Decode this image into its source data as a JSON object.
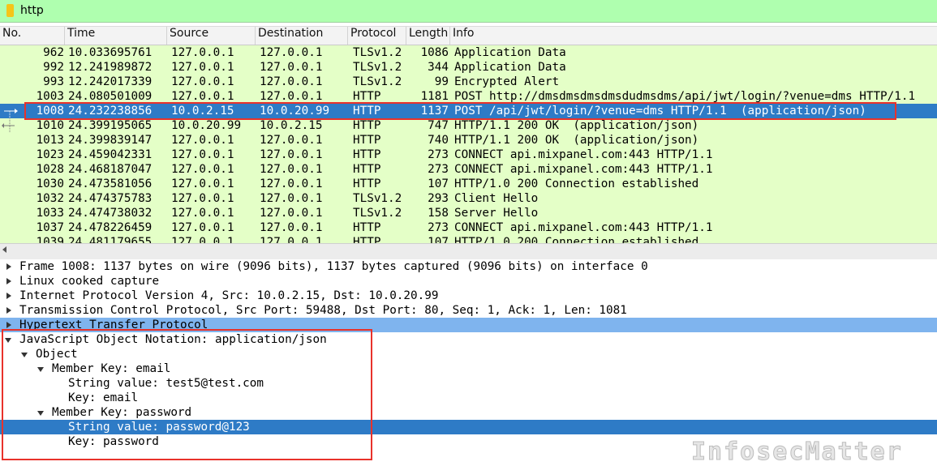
{
  "filter": {
    "value": "http"
  },
  "columns": [
    "No.",
    "Time",
    "Source",
    "Destination",
    "Protocol",
    "Length",
    "Info"
  ],
  "packets": [
    {
      "no": "962",
      "time": "10.033695761",
      "src": "127.0.0.1",
      "dst": "127.0.0.1",
      "proto": "TLSv1.2",
      "len": "1086",
      "info": "Application Data"
    },
    {
      "no": "992",
      "time": "12.241989872",
      "src": "127.0.0.1",
      "dst": "127.0.0.1",
      "proto": "TLSv1.2",
      "len": "344",
      "info": "Application Data"
    },
    {
      "no": "993",
      "time": "12.242017339",
      "src": "127.0.0.1",
      "dst": "127.0.0.1",
      "proto": "TLSv1.2",
      "len": "99",
      "info": "Encrypted Alert"
    },
    {
      "no": "1003",
      "time": "24.080501009",
      "src": "127.0.0.1",
      "dst": "127.0.0.1",
      "proto": "HTTP",
      "len": "1181",
      "info": "POST http://dmsdmsdmsdmsdudmsdms/api/jwt/login/?venue=dms HTTP/1.1"
    },
    {
      "no": "1008",
      "time": "24.232238856",
      "src": "10.0.2.15",
      "dst": "10.0.20.99",
      "proto": "HTTP",
      "len": "1137",
      "info": "POST /api/jwt/login/?venue=dms HTTP/1.1  (application/json)"
    },
    {
      "no": "1010",
      "time": "24.399195065",
      "src": "10.0.20.99",
      "dst": "10.0.2.15",
      "proto": "HTTP",
      "len": "747",
      "info": "HTTP/1.1 200 OK  (application/json)"
    },
    {
      "no": "1013",
      "time": "24.399839147",
      "src": "127.0.0.1",
      "dst": "127.0.0.1",
      "proto": "HTTP",
      "len": "740",
      "info": "HTTP/1.1 200 OK  (application/json)"
    },
    {
      "no": "1023",
      "time": "24.459042331",
      "src": "127.0.0.1",
      "dst": "127.0.0.1",
      "proto": "HTTP",
      "len": "273",
      "info": "CONNECT api.mixpanel.com:443 HTTP/1.1"
    },
    {
      "no": "1028",
      "time": "24.468187047",
      "src": "127.0.0.1",
      "dst": "127.0.0.1",
      "proto": "HTTP",
      "len": "273",
      "info": "CONNECT api.mixpanel.com:443 HTTP/1.1"
    },
    {
      "no": "1030",
      "time": "24.473581056",
      "src": "127.0.0.1",
      "dst": "127.0.0.1",
      "proto": "HTTP",
      "len": "107",
      "info": "HTTP/1.0 200 Connection established"
    },
    {
      "no": "1032",
      "time": "24.474375783",
      "src": "127.0.0.1",
      "dst": "127.0.0.1",
      "proto": "TLSv1.2",
      "len": "293",
      "info": "Client Hello"
    },
    {
      "no": "1033",
      "time": "24.474738032",
      "src": "127.0.0.1",
      "dst": "127.0.0.1",
      "proto": "TLSv1.2",
      "len": "158",
      "info": "Server Hello"
    },
    {
      "no": "1037",
      "time": "24.478226459",
      "src": "127.0.0.1",
      "dst": "127.0.0.1",
      "proto": "HTTP",
      "len": "273",
      "info": "CONNECT api.mixpanel.com:443 HTTP/1.1"
    },
    {
      "no": "1039",
      "time": "24.481179655",
      "src": "127.0.0.1",
      "dst": "127.0.0.1",
      "proto": "HTTP",
      "len": "107",
      "info": "HTTP/1.0 200 Connection established"
    }
  ],
  "selected_packet_index": 4,
  "details": [
    {
      "text": "Frame 1008: 1137 bytes on wire (9096 bits), 1137 bytes captured (9096 bits) on interface 0",
      "state": "collapsed",
      "level": 0
    },
    {
      "text": "Linux cooked capture",
      "state": "collapsed",
      "level": 0
    },
    {
      "text": "Internet Protocol Version 4, Src: 10.0.2.15, Dst: 10.0.20.99",
      "state": "collapsed",
      "level": 0
    },
    {
      "text": "Transmission Control Protocol, Src Port: 59488, Dst Port: 80, Seq: 1, Ack: 1, Len: 1081",
      "state": "collapsed",
      "level": 0
    },
    {
      "text": "Hypertext Transfer Protocol",
      "state": "collapsed",
      "level": 0,
      "highlight": "light"
    },
    {
      "text": "JavaScript Object Notation: application/json",
      "state": "expanded",
      "level": 0
    },
    {
      "text": "Object",
      "state": "expanded",
      "level": 1
    },
    {
      "text": "Member Key: email",
      "state": "expanded",
      "level": 2
    },
    {
      "text": "String value: test5@test.com",
      "state": "leaf",
      "level": 3
    },
    {
      "text": "Key: email",
      "state": "leaf",
      "level": 3
    },
    {
      "text": "Member Key: password",
      "state": "expanded",
      "level": 2
    },
    {
      "text": "String value: password@123",
      "state": "leaf",
      "level": 3,
      "highlight": "selected"
    },
    {
      "text": "Key: password",
      "state": "leaf",
      "level": 3
    }
  ],
  "watermark": "InfosecMatter",
  "colors": {
    "filter_bg": "#afffaf",
    "packet_bg": "#e4ffc7",
    "selection": "#2e7bc6",
    "http_highlight": "#7fb4ee",
    "annotation": "#e8322b"
  }
}
